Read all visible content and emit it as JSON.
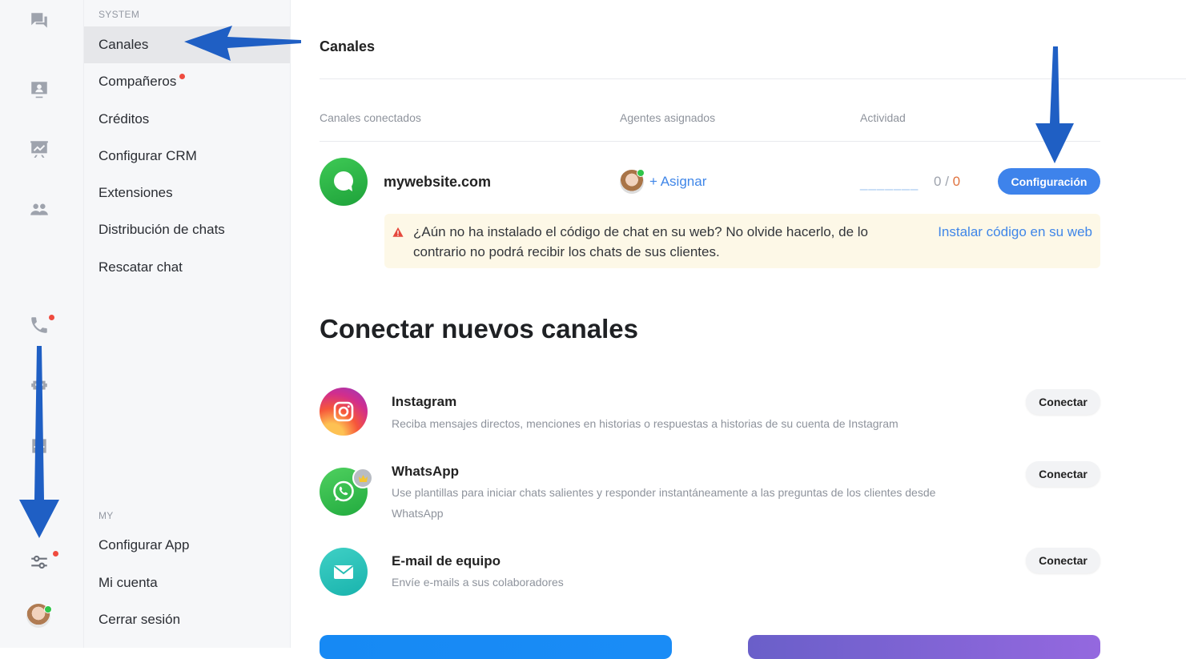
{
  "sidebar": {
    "system_label": "SYSTEM",
    "system_items": [
      {
        "label": "Canales",
        "active": true,
        "badge": false
      },
      {
        "label": "Compañeros",
        "active": false,
        "badge": true
      },
      {
        "label": "Créditos",
        "active": false,
        "badge": false
      },
      {
        "label": "Configurar CRM",
        "active": false,
        "badge": false
      },
      {
        "label": "Extensiones",
        "active": false,
        "badge": false
      },
      {
        "label": "Distribución de chats",
        "active": false,
        "badge": false
      },
      {
        "label": "Rescatar chat",
        "active": false,
        "badge": false
      }
    ],
    "my_label": "MY",
    "my_items": [
      {
        "label": "Configurar App"
      },
      {
        "label": "Mi cuenta"
      },
      {
        "label": "Cerrar sesión"
      }
    ]
  },
  "rail": {
    "icons": [
      "chats-icon",
      "visitors-icon",
      "reports-icon",
      "team-icon",
      "phone-icon",
      "bot-icon",
      "inbox-icon",
      "settings-sliders-icon",
      "avatar"
    ]
  },
  "main": {
    "title": "Canales",
    "columns": {
      "connected": "Canales conectados",
      "agents": "Agentes asignados",
      "activity": "Actividad"
    },
    "connected_channel": {
      "name": "mywebsite.com",
      "assign_label": "+ Asignar",
      "activity_placeholder": "_______",
      "count_active": "0",
      "count_sep": "/",
      "count_total": "0",
      "config_button": "Configuración"
    },
    "warning": {
      "text": "¿Aún no ha instalado el código de chat en su web? No olvide hacerlo, de lo contrario no podrá recibir los chats de sus clientes.",
      "link": "Instalar código en su web"
    },
    "new_channels_title": "Conectar nuevos canales",
    "new_channels": [
      {
        "name": "Instagram",
        "description": "Reciba mensajes directos, menciones en historias o respuestas a historias de su cuenta de Instagram",
        "button": "Conectar",
        "icon": "instagram-icon"
      },
      {
        "name": "WhatsApp",
        "description": "Use plantillas para iniciar chats salientes y responder instantáneamente a las preguntas de los clientes desde WhatsApp",
        "button": "Conectar",
        "icon": "whatsapp-icon"
      },
      {
        "name": "E-mail de equipo",
        "description": "Envíe e-mails a sus colaboradores",
        "button": "Conectar",
        "icon": "email-icon"
      }
    ]
  },
  "colors": {
    "accent": "#3e83eb",
    "link": "#3f86e8",
    "warning_bg": "#fdf8e7",
    "annotation_arrow": "#1f5fc4"
  }
}
